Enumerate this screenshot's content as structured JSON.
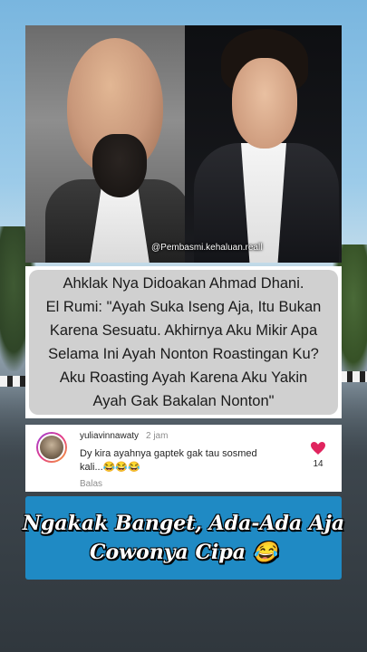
{
  "photo": {
    "watermark": "@Pembasmi.kehaluan.reall"
  },
  "caption": {
    "lines": [
      "Ahklak Nya Didoakan Ahmad Dhani.",
      "El Rumi: \"Ayah Suka Iseng Aja, Itu Bukan",
      "Karena Sesuatu. Akhirnya Aku Mikir Apa",
      "Selama Ini Ayah Nonton Roastingan Ku?",
      "Aku Roasting Ayah Karena Aku Yakin",
      "Ayah Gak Bakalan  Nonton\""
    ]
  },
  "comment": {
    "username": "yuliavinnawaty",
    "time": "2 jam",
    "text_line1": "Dy kira ayahnya gaptek gak tau sosmed",
    "text_line2": "kali...😂😂😂",
    "reply_label": "Balas",
    "like_count": "14",
    "heart_color": "#e0245e"
  },
  "banner": {
    "line1": "Ngakak Banget, Ada-Ada Aja",
    "line2": "Cowonya Cipa 😂",
    "background": "#1f8ac4"
  }
}
